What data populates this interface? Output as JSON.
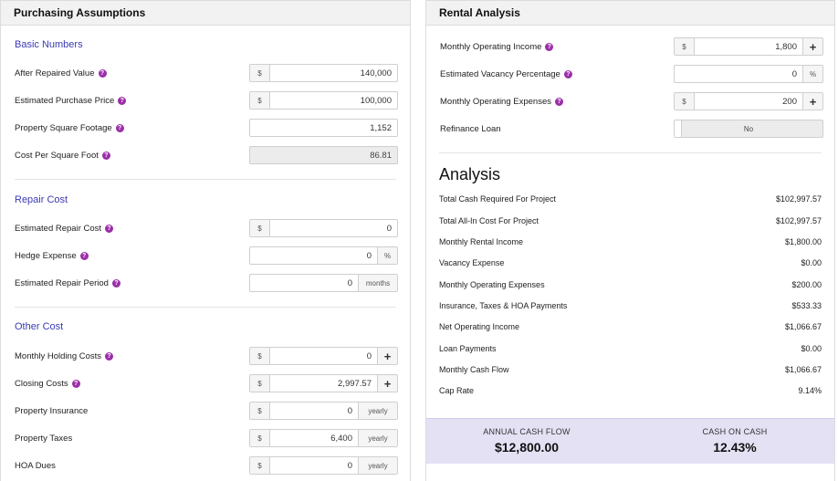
{
  "left": {
    "title": "Purchasing Assumptions",
    "basic": {
      "title": "Basic Numbers",
      "after_repaired_value": {
        "label": "After Repaired Value",
        "prefix": "$",
        "value": "140,000"
      },
      "purchase_price": {
        "label": "Estimated Purchase Price",
        "prefix": "$",
        "value": "100,000"
      },
      "square_footage": {
        "label": "Property Square Footage",
        "value": "1,152"
      },
      "cost_per_sqft": {
        "label": "Cost Per Square Foot",
        "value": "86.81"
      }
    },
    "repair": {
      "title": "Repair Cost",
      "repair_cost": {
        "label": "Estimated Repair Cost",
        "prefix": "$",
        "value": "0"
      },
      "hedge_expense": {
        "label": "Hedge Expense",
        "value": "0",
        "suffix": "%"
      },
      "repair_period": {
        "label": "Estimated Repair Period",
        "value": "0",
        "suffix": "months"
      }
    },
    "other": {
      "title": "Other Cost",
      "holding_costs": {
        "label": "Monthly Holding Costs",
        "prefix": "$",
        "value": "0",
        "suffix": "+"
      },
      "closing_costs": {
        "label": "Closing Costs",
        "prefix": "$",
        "value": "2,997.57",
        "suffix": "+"
      },
      "insurance": {
        "label": "Property Insurance",
        "prefix": "$",
        "value": "0",
        "suffix": "yearly"
      },
      "taxes": {
        "label": "Property Taxes",
        "prefix": "$",
        "value": "6,400",
        "suffix": "yearly"
      },
      "hoa": {
        "label": "HOA Dues",
        "prefix": "$",
        "value": "0",
        "suffix": "yearly"
      }
    }
  },
  "right": {
    "title": "Rental Analysis",
    "income": {
      "label": "Monthly Operating Income",
      "prefix": "$",
      "value": "1,800",
      "suffix": "+"
    },
    "vacancy": {
      "label": "Estimated Vacancy Percentage",
      "value": "0",
      "suffix": "%"
    },
    "expenses": {
      "label": "Monthly Operating Expenses",
      "prefix": "$",
      "value": "200",
      "suffix": "+"
    },
    "refinance": {
      "label": "Refinance Loan",
      "value": "No"
    },
    "analysis": {
      "title": "Analysis",
      "rows": [
        {
          "label": "Total Cash Required For Project",
          "value": "$102,997.57"
        },
        {
          "label": "Total All-In Cost For Project",
          "value": "$102,997.57"
        },
        {
          "label": "Monthly Rental Income",
          "value": "$1,800.00"
        },
        {
          "label": "Vacancy Expense",
          "value": "$0.00"
        },
        {
          "label": "Monthly Operating Expenses",
          "value": "$200.00"
        },
        {
          "label": "Insurance, Taxes & HOA Payments",
          "value": "$533.33"
        },
        {
          "label": "Net Operating Income",
          "value": "$1,066.67"
        },
        {
          "label": "Loan Payments",
          "value": "$0.00"
        },
        {
          "label": "Monthly Cash Flow",
          "value": "$1,066.67"
        },
        {
          "label": "Cap Rate",
          "value": "9.14%"
        }
      ]
    },
    "summary": {
      "annual_label": "ANNUAL CASH FLOW",
      "annual_value": "$12,800.00",
      "coc_label": "CASH ON CASH",
      "coc_value": "12.43%"
    }
  },
  "help_glyph": "?",
  "colors": {
    "accent": "#3a3ab5",
    "help": "#9b2fa8",
    "summary_bg": "#e4e1f5"
  }
}
